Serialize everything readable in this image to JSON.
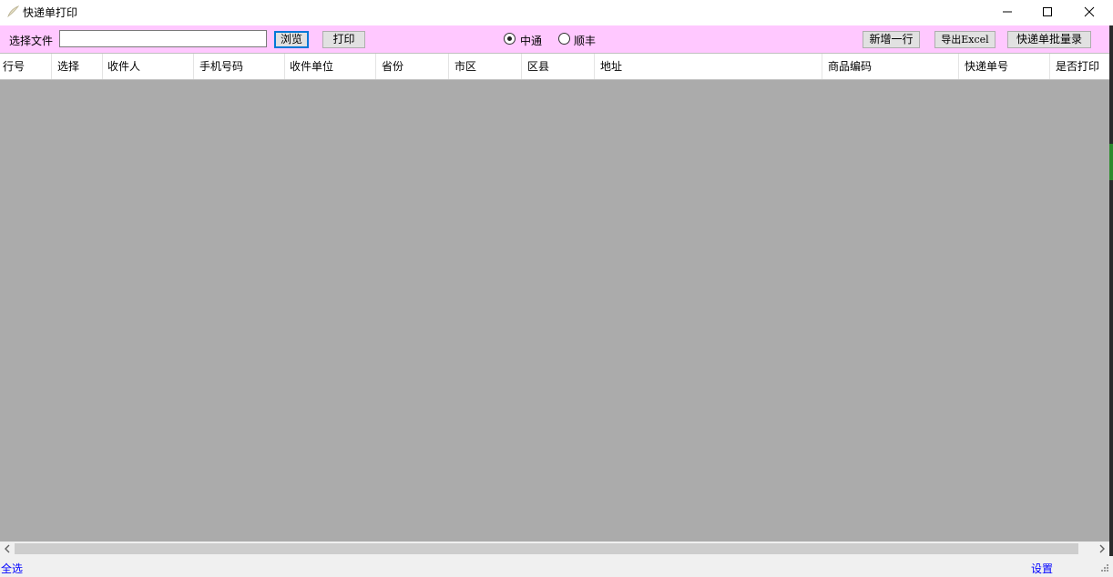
{
  "window": {
    "title": "快递单打印",
    "icon": "app-feather-icon",
    "controls": {
      "minimize": "minimize-icon",
      "maximize": "maximize-icon",
      "close": "close-icon"
    }
  },
  "toolbar": {
    "file_label": "选择文件",
    "file_value": "",
    "browse_label": "浏览",
    "print_label": "打印",
    "carriers": [
      {
        "label": "中通",
        "selected": true
      },
      {
        "label": "顺丰",
        "selected": false
      }
    ],
    "add_row_label": "新增一行",
    "export_label": "导出Excel",
    "batch_entry_label": "快递单批量录",
    "background_color": "#ffc8ff"
  },
  "grid": {
    "columns": [
      "行号",
      "选择",
      "收件人",
      "手机号码",
      "收件单位",
      "省份",
      "市区",
      "区县",
      "地址",
      "商品编码",
      "快递单号",
      "是否打印"
    ],
    "rows": [],
    "background_color": "#ababab"
  },
  "status": {
    "select_all_label": "全选",
    "settings_label": "设置"
  }
}
